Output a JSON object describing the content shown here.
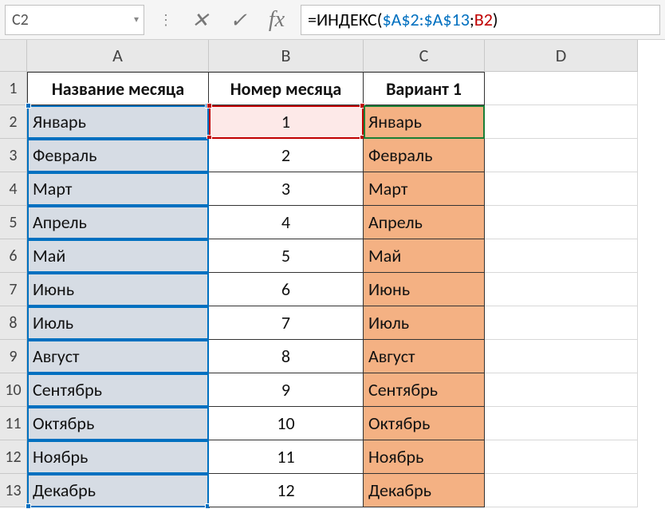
{
  "nameBox": {
    "value": "C2"
  },
  "formulaBar": {
    "prefix": "=ИНДЕКС(",
    "ref1": "$A$2:$A$13",
    "sep": ";",
    "ref2": "B2",
    "suffix": ")"
  },
  "columns": [
    "A",
    "B",
    "C",
    "D"
  ],
  "rowNumbers": [
    "1",
    "2",
    "3",
    "4",
    "5",
    "6",
    "7",
    "8",
    "9",
    "10",
    "11",
    "12",
    "13"
  ],
  "headers": {
    "a": "Название месяца",
    "b": "Номер месяца",
    "c": "Вариант 1"
  },
  "data": [
    {
      "a": "Январь",
      "b": "1",
      "c": "Январь"
    },
    {
      "a": "Февраль",
      "b": "2",
      "c": "Февраль"
    },
    {
      "a": "Март",
      "b": "3",
      "c": "Март"
    },
    {
      "a": "Апрель",
      "b": "4",
      "c": "Апрель"
    },
    {
      "a": "Май",
      "b": "5",
      "c": "Май"
    },
    {
      "a": "Июнь",
      "b": "6",
      "c": "Июнь"
    },
    {
      "a": "Июль",
      "b": "7",
      "c": "Июль"
    },
    {
      "a": "Август",
      "b": "8",
      "c": "Август"
    },
    {
      "a": "Сентябрь",
      "b": "9",
      "c": "Сентябрь"
    },
    {
      "a": "Октябрь",
      "b": "10",
      "c": "Октябрь"
    },
    {
      "a": "Ноябрь",
      "b": "11",
      "c": "Ноябрь"
    },
    {
      "a": "Декабрь",
      "b": "12",
      "c": "Декабрь"
    }
  ],
  "icons": {
    "cancel": "✕",
    "enter": "✓",
    "fx": "fx",
    "dropdown": "▾",
    "vdots": "⋮"
  }
}
